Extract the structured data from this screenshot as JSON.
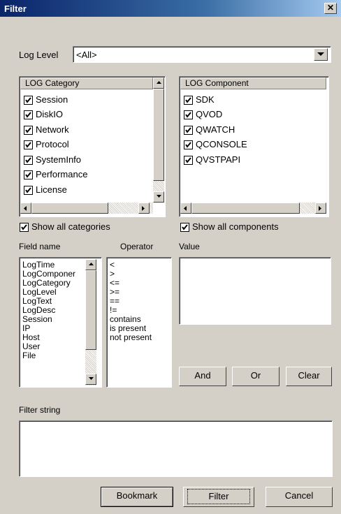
{
  "window": {
    "title": "Filter",
    "close": "✕"
  },
  "log_level": {
    "label": "Log Level",
    "value": "<All>"
  },
  "category": {
    "header": "LOG Category",
    "items": [
      "Session",
      "DiskIO",
      "Network",
      "Protocol",
      "SystemInfo",
      "Performance",
      "License"
    ],
    "show_all_label": "Show all categories"
  },
  "component": {
    "header": "LOG Component",
    "items": [
      "SDK",
      "QVOD",
      "QWATCH",
      "QCONSOLE",
      "QVSTPAPI"
    ],
    "show_all_label": "Show all components"
  },
  "field_name": {
    "label": "Field name",
    "items": [
      "LogTime",
      "LogComponer",
      "LogCategory",
      "LogLevel",
      "LogText",
      "LogDesc",
      "Session",
      "IP",
      "Host",
      "User",
      "File"
    ]
  },
  "operator": {
    "label": "Operator",
    "items": [
      "<",
      ">",
      "<=",
      ">=",
      "==",
      "!=",
      "contains",
      "is present",
      "not present"
    ]
  },
  "value": {
    "label": "Value"
  },
  "buttons": {
    "and": "And",
    "or": "Or",
    "clear": "Clear",
    "bookmark": "Bookmark",
    "filter": "Filter",
    "cancel": "Cancel"
  },
  "filter_string": {
    "label": "Filter string"
  }
}
